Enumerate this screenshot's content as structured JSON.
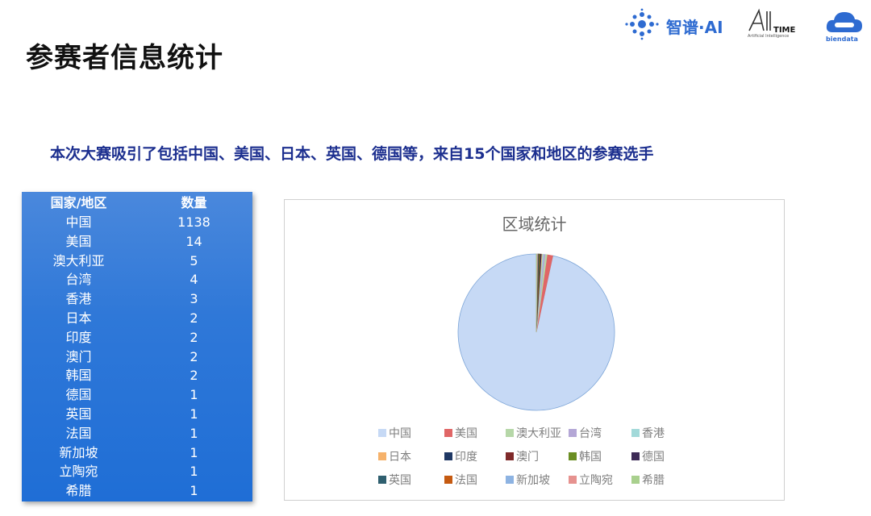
{
  "page": {
    "title": "参赛者信息统计",
    "subtitle": "本次大赛吸引了包括中国、美国、日本、英国、德国等，来自15个国家和地区的参赛选手"
  },
  "logos": {
    "zhipu": "智谱·AI",
    "aitime": "TIME",
    "aitime_sub": "Artificial Intelligence",
    "biendata": "biendata"
  },
  "table": {
    "headers": [
      "国家/地区",
      "数量"
    ],
    "rows": [
      [
        "中国",
        "1138"
      ],
      [
        "美国",
        "14"
      ],
      [
        "澳大利亚",
        "5"
      ],
      [
        "台湾",
        "4"
      ],
      [
        "香港",
        "3"
      ],
      [
        "日本",
        "2"
      ],
      [
        "印度",
        "2"
      ],
      [
        "澳门",
        "2"
      ],
      [
        "韩国",
        "2"
      ],
      [
        "德国",
        "1"
      ],
      [
        "英国",
        "1"
      ],
      [
        "法国",
        "1"
      ],
      [
        "新加坡",
        "1"
      ],
      [
        "立陶宛",
        "1"
      ],
      [
        "希腊",
        "1"
      ]
    ]
  },
  "chart_data": {
    "type": "pie",
    "title": "区域统计",
    "categories": [
      "中国",
      "美国",
      "澳大利亚",
      "台湾",
      "香港",
      "日本",
      "印度",
      "澳门",
      "韩国",
      "德国",
      "英国",
      "法国",
      "新加坡",
      "立陶宛",
      "希腊"
    ],
    "values": [
      1138,
      14,
      5,
      4,
      3,
      2,
      2,
      2,
      2,
      1,
      1,
      1,
      1,
      1,
      1
    ],
    "colors": [
      "#c6d9f5",
      "#e06666",
      "#b6d7a8",
      "#b4a7d6",
      "#a2d9d9",
      "#f6b26b",
      "#1f3864",
      "#7f2a2a",
      "#6b8e23",
      "#3d2b56",
      "#2f5f6f",
      "#c55a11",
      "#8db3e2",
      "#e6928f",
      "#a9d08e"
    ],
    "legend_position": "bottom"
  }
}
